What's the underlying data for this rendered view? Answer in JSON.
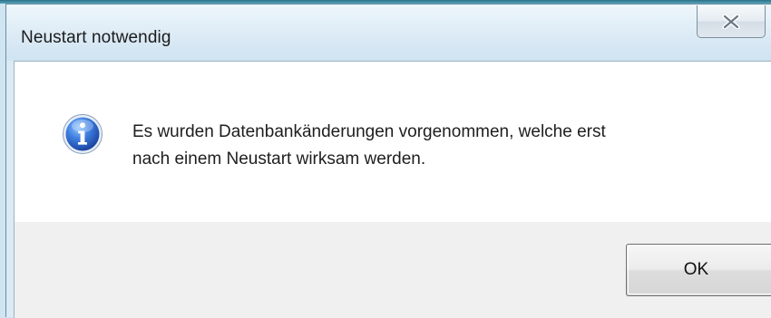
{
  "window": {
    "title": "Neustart notwendig",
    "close_icon": "close-x-icon"
  },
  "message": {
    "icon": "information-icon",
    "text": "Es wurden Datenbankänderungen vorgenommen, welche erst\nnach einem Neustart wirksam werden."
  },
  "buttons": {
    "ok_label": "OK"
  },
  "colors": {
    "window_frame": "#dbeaf4",
    "content_background": "#ffffff",
    "button_area": "#f0f0f0",
    "info_icon_blue": "#2b63c8"
  }
}
